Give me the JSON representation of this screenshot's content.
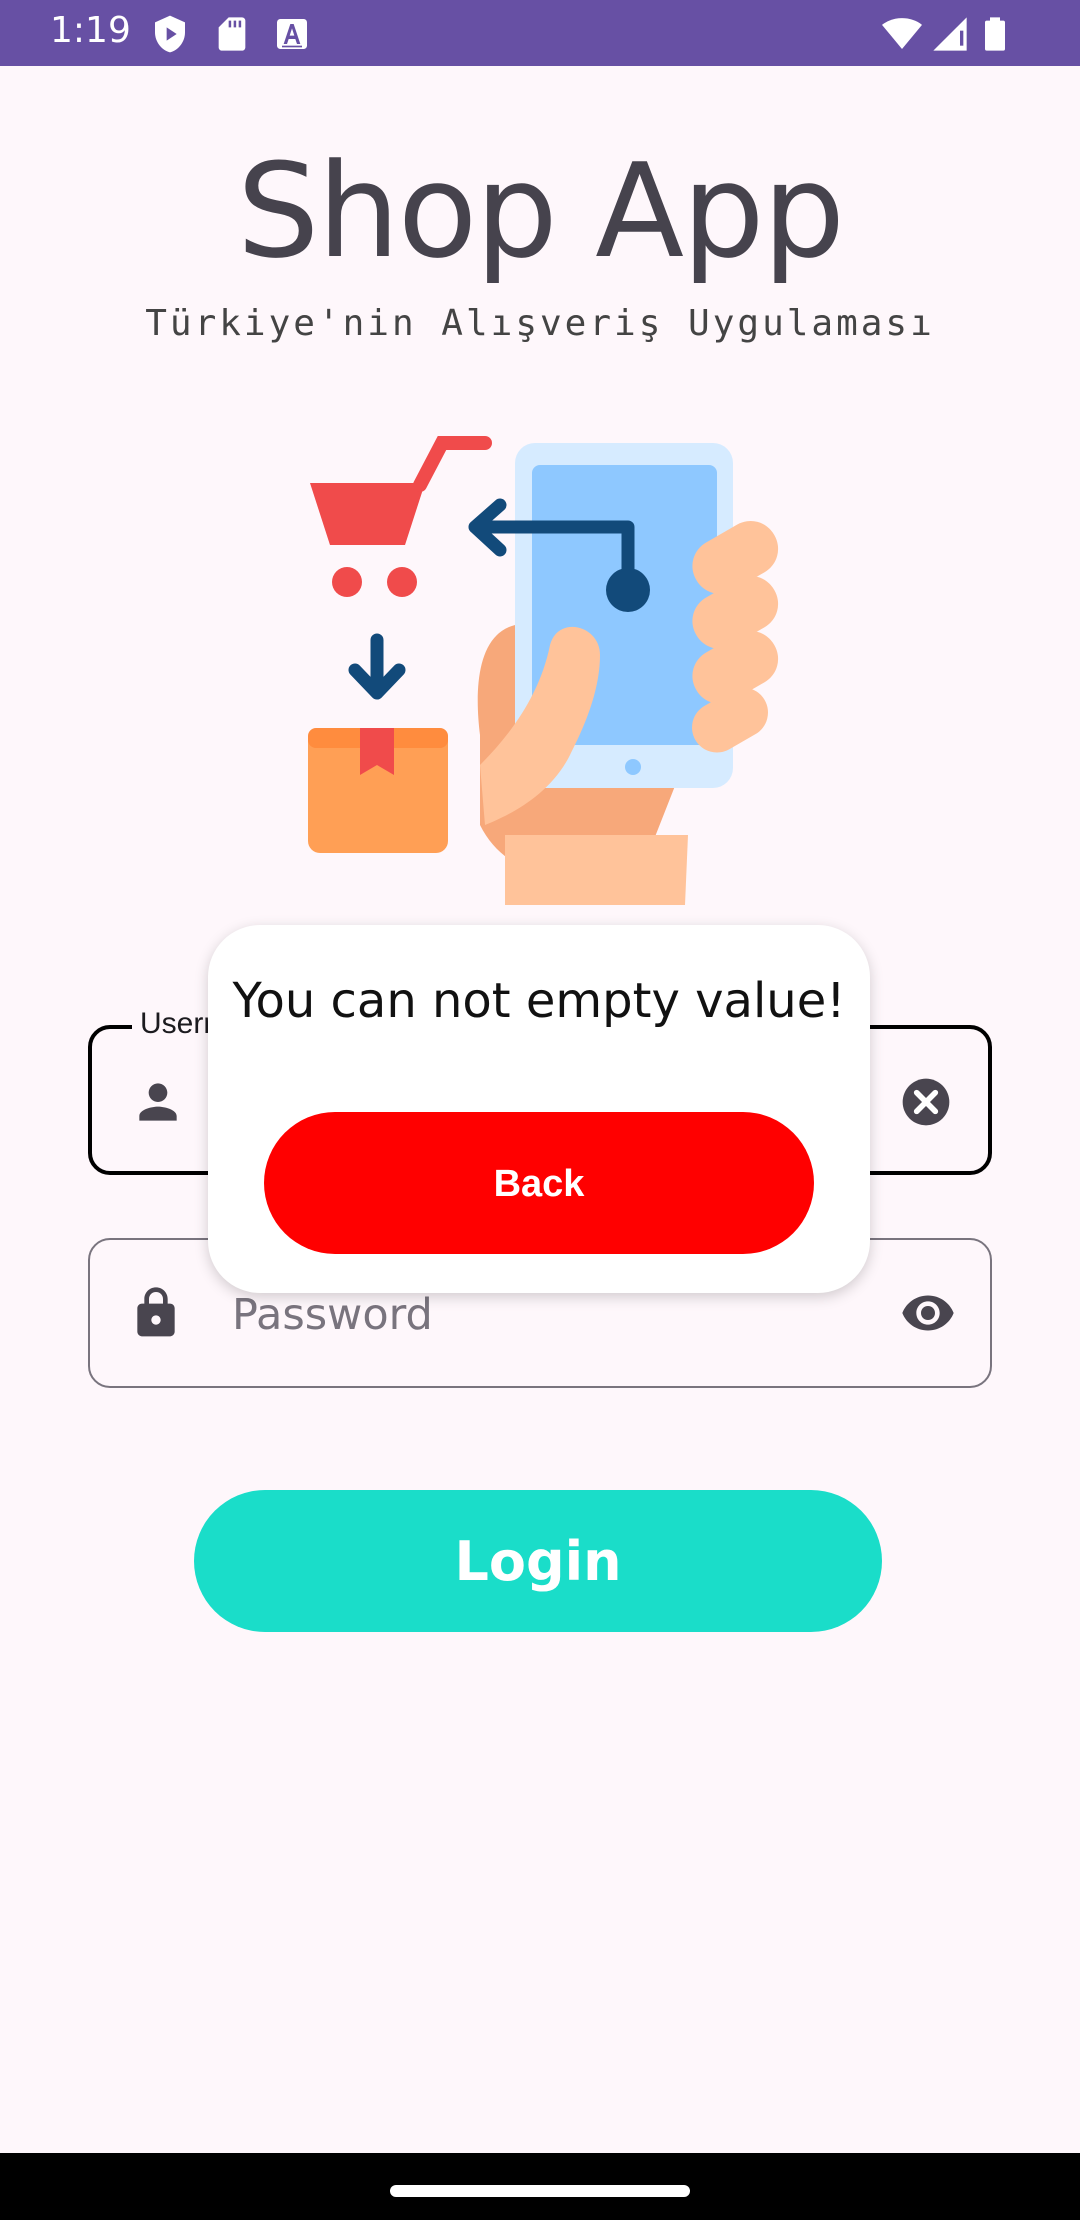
{
  "status_bar": {
    "time": "1:19",
    "left_icons": [
      "shield-play-icon",
      "sd-card-icon",
      "keyboard-a-icon"
    ],
    "right_icons": [
      "wifi-icon",
      "signal-icon",
      "battery-icon"
    ]
  },
  "app": {
    "title": "Shop App",
    "subtitle": "Türkiye'nin Alışveriş Uygulaması",
    "illustration": "shopping-phone-hand-illustration"
  },
  "form": {
    "username_label": "Userr",
    "username_value": "",
    "password_placeholder": "Password",
    "login_label": "Login"
  },
  "dialog": {
    "message": "You can not empty value!",
    "back_label": "Back"
  },
  "colors": {
    "status_bar": "#6750a4",
    "login_button": "#1addc9",
    "back_button": "#ff0000",
    "background": "#fef7fb"
  }
}
